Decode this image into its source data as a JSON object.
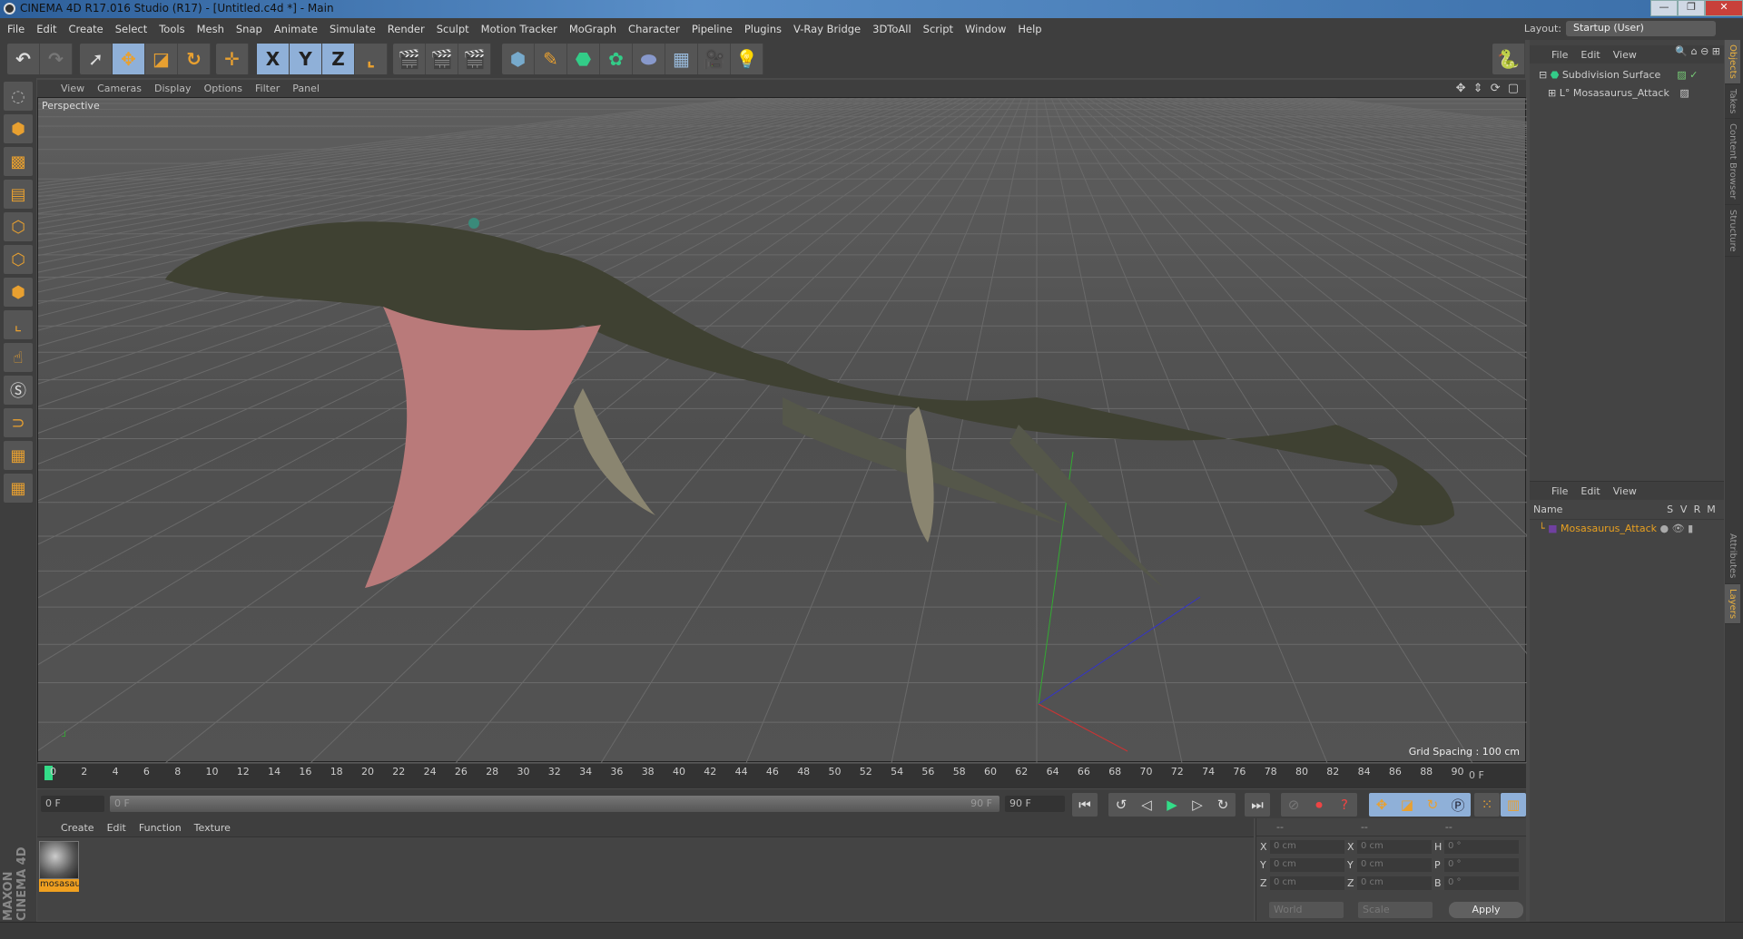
{
  "window": {
    "title": "CINEMA 4D R17.016 Studio (R17) - [Untitled.c4d *] - Main",
    "controls": [
      "—",
      "❐",
      "✕"
    ]
  },
  "menu": [
    "File",
    "Edit",
    "Create",
    "Select",
    "Tools",
    "Mesh",
    "Snap",
    "Animate",
    "Simulate",
    "Render",
    "Sculpt",
    "Motion Tracker",
    "MoGraph",
    "Character",
    "Pipeline",
    "Plugins",
    "V-Ray Bridge",
    "3DToAll",
    "Script",
    "Window",
    "Help"
  ],
  "layout": {
    "label": "Layout:",
    "value": "Startup (User)"
  },
  "toolbar": {
    "axes": [
      "X",
      "Y",
      "Z"
    ]
  },
  "viewport": {
    "menu": [
      "View",
      "Cameras",
      "Display",
      "Options",
      "Filter",
      "Panel"
    ],
    "label": "Perspective",
    "grid_spacing": "Grid Spacing : 100 cm"
  },
  "timeline": {
    "ticks": [
      "0",
      "2",
      "4",
      "6",
      "8",
      "10",
      "12",
      "14",
      "16",
      "18",
      "20",
      "22",
      "24",
      "26",
      "28",
      "30",
      "32",
      "34",
      "36",
      "38",
      "40",
      "42",
      "44",
      "46",
      "48",
      "50",
      "52",
      "54",
      "56",
      "58",
      "60",
      "62",
      "64",
      "66",
      "68",
      "70",
      "72",
      "74",
      "76",
      "78",
      "80",
      "82",
      "84",
      "86",
      "88",
      "90"
    ],
    "current_frame": "0 F",
    "start": "0 F",
    "slider_start": "0 F",
    "slider_end": "90 F",
    "end": "90 F"
  },
  "materials": {
    "menu": [
      "Create",
      "Edit",
      "Function",
      "Texture"
    ],
    "items": [
      {
        "name": "mosasau"
      }
    ]
  },
  "coords": {
    "headers": [
      "--",
      "--",
      "--"
    ],
    "rows": [
      {
        "a": "X",
        "av": "0 cm",
        "b": "X",
        "bv": "0 cm",
        "c": "H",
        "cv": "0 °"
      },
      {
        "a": "Y",
        "av": "0 cm",
        "b": "Y",
        "bv": "0 cm",
        "c": "P",
        "cv": "0 °"
      },
      {
        "a": "Z",
        "av": "0 cm",
        "b": "Z",
        "bv": "0 cm",
        "c": "B",
        "cv": "0 °"
      }
    ],
    "mode1": "World",
    "mode2": "Scale",
    "apply": "Apply"
  },
  "objects": {
    "menu": [
      "File",
      "Edit",
      "View"
    ],
    "items": [
      "Subdivision Surface",
      "Mosasaurus_Attack"
    ]
  },
  "layers": {
    "menu": [
      "File",
      "Edit",
      "View"
    ],
    "columns": [
      "Name",
      "S",
      "V",
      "R",
      "M"
    ],
    "items": [
      "Mosasaurus_Attack"
    ]
  },
  "vtabs": [
    "Objects",
    "Takes",
    "Content Browser",
    "Structure",
    "Attributes",
    "Layers"
  ],
  "brand": "MAXON CINEMA 4D",
  "colors": {
    "accent": "#e8a030",
    "selected": "#8fb0d8",
    "layer_name": "#e8a020"
  }
}
